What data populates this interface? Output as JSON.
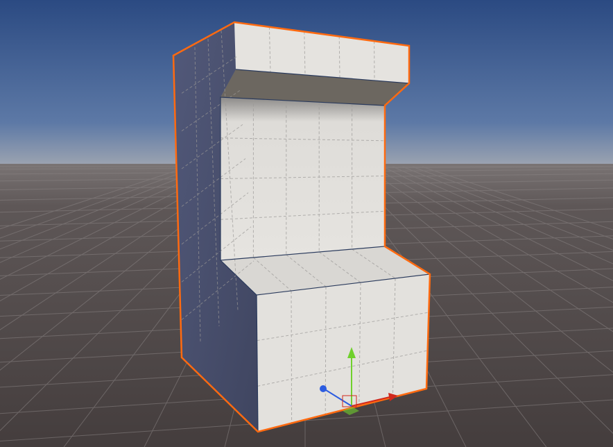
{
  "viewport": {
    "colors": {
      "sky_top": "#2b4a82",
      "sky_horizon": "#8f9aad",
      "ground_near": "#4a4343",
      "ground_far": "#6a6462",
      "selection_outline": "#ff6a10",
      "gizmo_x": "#d0281c",
      "gizmo_y": "#6fd02c",
      "gizmo_z": "#2c5ce0"
    },
    "selected_object_icons": [
      "move-gizmo-icon"
    ]
  }
}
